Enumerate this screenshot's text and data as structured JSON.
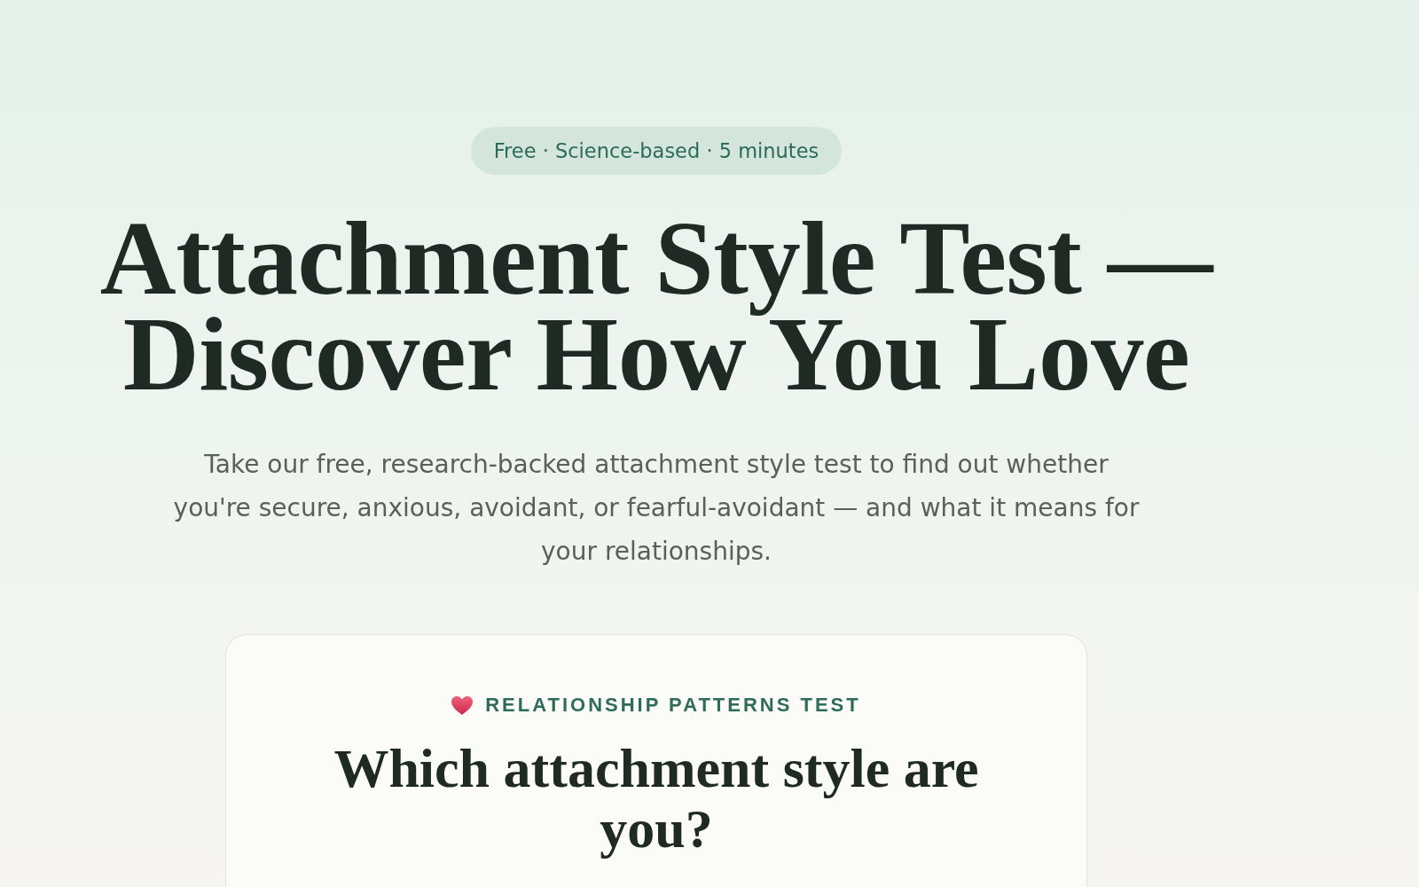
{
  "hero": {
    "badge": "Free · Science-based · 5 minutes",
    "title": "Attachment Style Test — Discover How You Love",
    "intro": "Take our free, research-backed attachment style test to find out whether you're secure, anxious, avoidant, or fearful-avoidant — and what it means for your relationships."
  },
  "quiz_card": {
    "eyebrow": "RELATIONSHIP PATTERNS TEST",
    "question": "Which attachment style are you?"
  }
}
